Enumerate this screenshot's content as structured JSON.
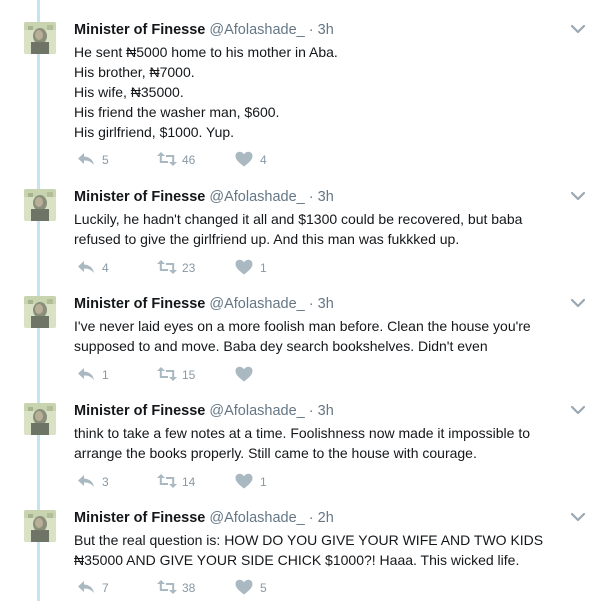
{
  "tweets": [
    {
      "name": "Minister of Finesse",
      "handle": "@Afolashade_",
      "dot": "·",
      "time": "3h",
      "lines": [
        "He sent ₦5000 home to his mother in Aba.",
        "His brother, ₦7000.",
        "His wife, ₦35000.",
        "His friend the washer man, $600.",
        "His girlfriend, $1000. Yup."
      ],
      "replies": "5",
      "retweets": "46",
      "likes": "4"
    },
    {
      "name": "Minister of Finesse",
      "handle": "@Afolashade_",
      "dot": "·",
      "time": "3h",
      "lines": [
        "Luckily, he hadn't changed it all and $1300 could be recovered, but baba",
        "refused to give the girlfriend up. And this man was fukkked up."
      ],
      "replies": "4",
      "retweets": "23",
      "likes": "1"
    },
    {
      "name": "Minister of Finesse",
      "handle": "@Afolashade_",
      "dot": "·",
      "time": "3h",
      "lines": [
        "I've never laid eyes on a more foolish man before. Clean the house you're",
        "supposed to and move. Baba dey search bookshelves. Didn't even"
      ],
      "replies": "1",
      "retweets": "15",
      "likes": ""
    },
    {
      "name": "Minister of Finesse",
      "handle": "@Afolashade_",
      "dot": "·",
      "time": "3h",
      "lines": [
        "think to take a few notes at a time. Foolishness now made it impossible to",
        "arrange the books properly. Still came to the house with courage."
      ],
      "replies": "3",
      "retweets": "14",
      "likes": "1"
    },
    {
      "name": "Minister of Finesse",
      "handle": "@Afolashade_",
      "dot": "·",
      "time": "2h",
      "lines": [
        "But the real question is: HOW DO YOU GIVE YOUR WIFE AND TWO KIDS",
        "₦35000 AND GIVE YOUR SIDE CHICK $1000?! Haaa. This wicked life."
      ],
      "replies": "7",
      "retweets": "38",
      "likes": "5"
    }
  ],
  "icons": {
    "reply": "reply-icon",
    "retweet": "retweet-icon",
    "like": "heart-icon",
    "menu": "chevron-down-icon"
  },
  "colors": {
    "thread_line": "#c4e3f3",
    "icon_gray": "#aab8c2",
    "count_gray": "#8899a6",
    "meta_gray": "#657786"
  }
}
